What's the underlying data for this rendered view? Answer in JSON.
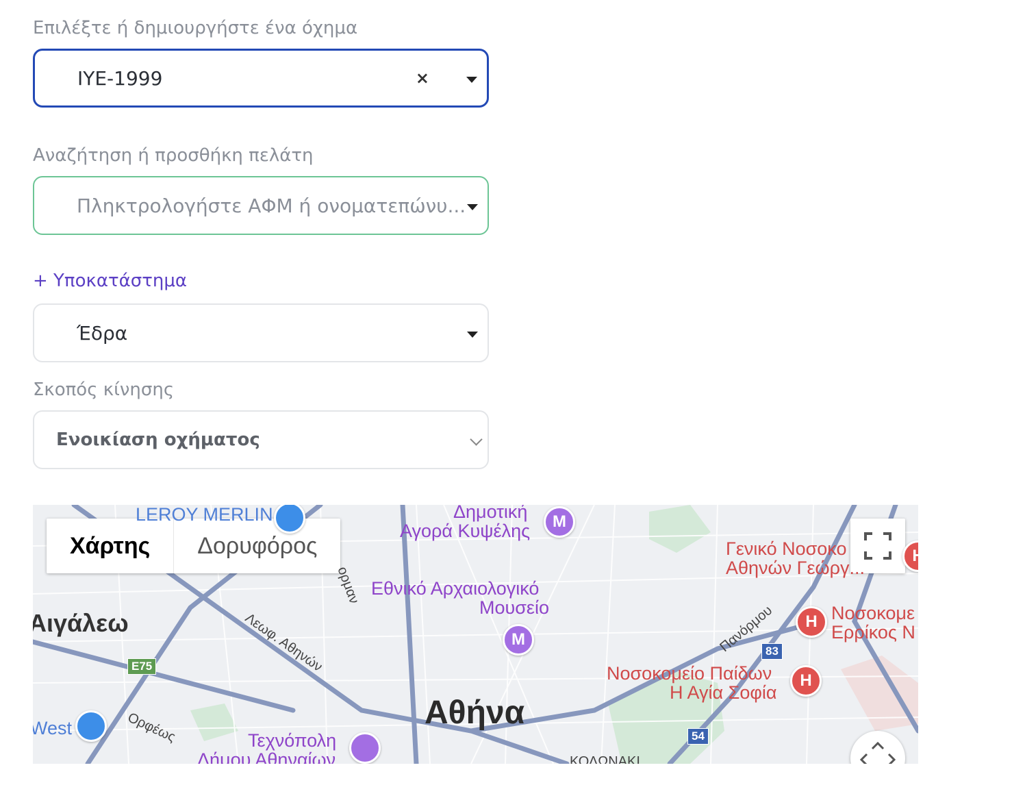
{
  "vehicle": {
    "label": "Επιλέξτε ή δημιουργήστε ένα όχημα",
    "value": "ΙΥΕ-1999",
    "clear_symbol": "×"
  },
  "customer": {
    "label": "Αναζήτηση ή προσθήκη πελάτη",
    "placeholder": "Πληκτρολογήστε ΑΦΜ ή ονοματεπώνυ..."
  },
  "branch": {
    "link_label": "+ Υποκατάστημα",
    "value": "Έδρα"
  },
  "purpose": {
    "label": "Σκοπός κίνησης",
    "value": "Ενοικίαση οχήματος"
  },
  "map": {
    "type_options": [
      "Χάρτης",
      "Δορυφόρος"
    ],
    "city": "Αθήνα",
    "area": "Αιγάλεω",
    "poi": {
      "leroy": "LEROY MERLIN",
      "agora_1": "Δημοτική",
      "agora_2": "Αγορά Κυψέλης",
      "museum_1": "Εθνικό Αρχαιολογικό",
      "museum_2": "Μουσείο",
      "hospital_general_1": "Γενικό Νοσοκο",
      "hospital_general_2": "Αθηνών Γεώργ...",
      "hospital_errikos_1": "Νοσοκομε",
      "hospital_errikos_2": "Ερρίκος Ν",
      "hospital_children_1": "Νοσοκομείο Παίδων",
      "hospital_children_2": "Η Αγία Σοφία",
      "technopolis_1": "Τεχνόπολη",
      "technopolis_2": "Δήμου Αθηναίων",
      "west": "West",
      "kolonaki": "ΚΟΛΩΝΑΚΙ"
    },
    "roads": {
      "athinon": "Λεωφ. Αθηνών",
      "orfeos": "Ορφέως",
      "panormou": "Πανόρμου",
      "orman": "ορμαν"
    },
    "shields": {
      "e75": "E75",
      "r83": "83",
      "r54": "54"
    },
    "pin_glyphs": {
      "hospital": "H",
      "museum": "M"
    },
    "colors": {
      "road": "#7f90b8",
      "park": "#cfe6d3",
      "water": "#a9cbe6"
    }
  }
}
